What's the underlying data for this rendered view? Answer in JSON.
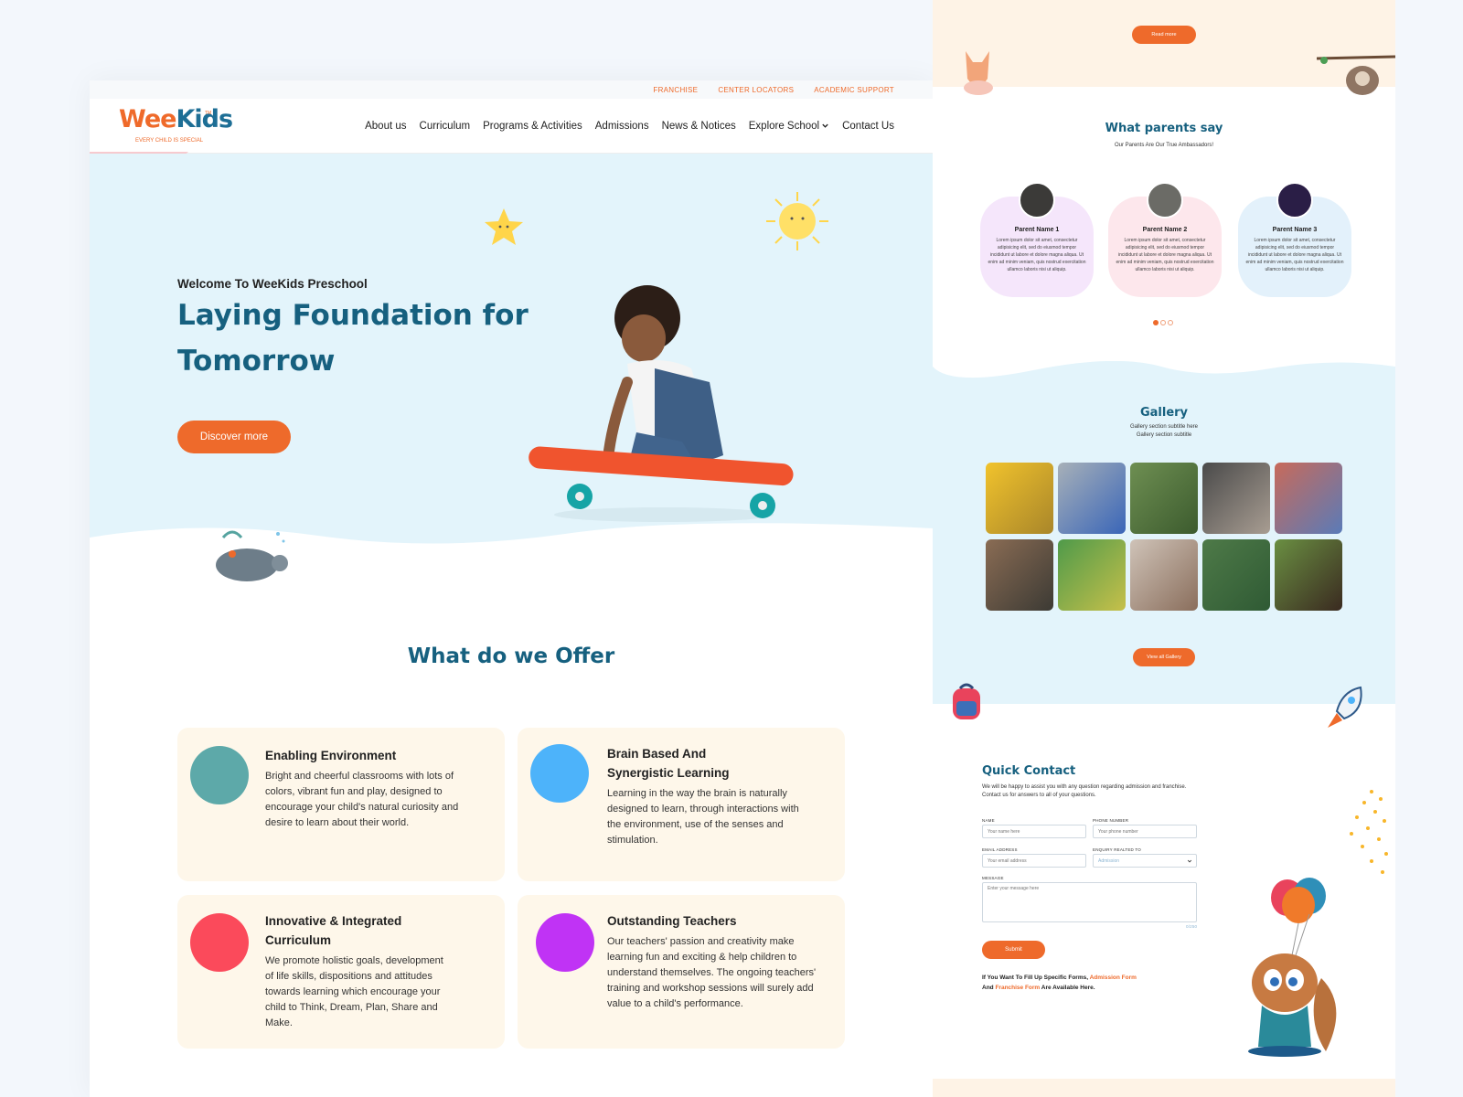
{
  "topbar": {
    "links": [
      "FRANCHISE",
      "CENTER LOCATORS",
      "ACADEMIC SUPPORT"
    ]
  },
  "brand": {
    "name_wee": "Wee",
    "name_kids": "Kids",
    "tagline": "EVERY CHILD IS SPECIAL",
    "tm": "TM"
  },
  "nav": {
    "items": [
      "About us",
      "Curriculum",
      "Programs & Activities",
      "Admissions",
      "News & Notices",
      "Explore School",
      "Contact Us"
    ]
  },
  "hero": {
    "welcome": "Welcome To WeeKids Preschool",
    "title": "Laying Foundation for Tomorrow",
    "button": "Discover more"
  },
  "offer": {
    "title": "What do we Offer",
    "cards": [
      {
        "title": "Enabling Environment",
        "text": "Bright and cheerful classrooms with lots of colors, vibrant fun and play, designed to encourage your child's natural curiosity and desire to learn about their world.",
        "color": "#5da9a9"
      },
      {
        "title": "Brain Based And Synergistic Learning",
        "text": "Learning in the way the brain is naturally designed to learn, through interactions with the environment, use of the senses and stimulation.",
        "color": "#4db3fa"
      },
      {
        "title": "Innovative & Integrated Curriculum",
        "text": "We promote holistic goals, development of life skills, dispositions and attitudes towards learning which encourage your child to Think, Dream, Plan, Share and Make.",
        "color": "#fb4a5b"
      },
      {
        "title": "Outstanding Teachers",
        "text": "Our teachers' passion and creativity make learning fun and exciting & help children to understand themselves. The ongoing teachers' training and workshop sessions will surely add value to a child's performance.",
        "color": "#c033f5"
      }
    ]
  },
  "right": {
    "read_more": "Read more",
    "testimonials": {
      "title": "What parents say",
      "subtitle": "Our Parents Are Our True Ambassadors!",
      "items": [
        {
          "name": "Parent Name 1",
          "text": "Lorem ipsum dolor sit amet, consectetur adipisicing elit, sed do eiusmod tempor incididunt ut labore et dolore magna aliqua. Ut enim ad minim veniam, quis nostrud exercitation ullamco laboris nisi ut aliquip.",
          "bg": "#f5e6fb"
        },
        {
          "name": "Parent Name 2",
          "text": "Lorem ipsum dolor sit amet, consectetur adipisicing elit, sed do eiusmod tempor incididunt ut labore et dolore magna aliqua. Ut enim ad minim veniam, quis nostrud exercitation ullamco laboris nisi ut aliquip.",
          "bg": "#fde7ec"
        },
        {
          "name": "Parent Name 3",
          "text": "Lorem ipsum dolor sit amet, consectetur adipisicing elit, sed do eiusmod tempor incididunt ut labore et dolore magna aliqua. Ut enim ad minim veniam, quis nostrud exercitation ullamco laboris nisi ut aliquip.",
          "bg": "#e3f1fb"
        }
      ]
    },
    "gallery": {
      "title": "Gallery",
      "subtitle1": "Gallery section subtitle here",
      "subtitle2": "Gallery section subtitle",
      "button": "View all Gallery"
    },
    "contact": {
      "title": "Quick Contact",
      "desc": "We will be happy to assist you with any question regarding admission and franchise. Contact us for answers to all of your questions.",
      "name_label": "NAME",
      "name_ph": "Your name here",
      "phone_label": "PHONE NUMBER",
      "phone_ph": "Your phone number",
      "email_label": "EMAIL ADDRESS",
      "email_ph": "Your email address",
      "enquiry_label": "ENQUIRY REALTED TO",
      "enquiry_value": "Admission",
      "message_label": "MESSAGE",
      "message_ph": "Enter your message here",
      "counter": "0/250",
      "submit": "Submit",
      "foot_a": "If You Want To Fill Up Specific Forms, ",
      "foot_link1": "Admission Form",
      "foot_b": " And ",
      "foot_link2": "Franchise Form",
      "foot_c": " Are Available Here."
    }
  },
  "colors": {
    "accent": "#ee6a2b",
    "heading": "#16607f",
    "hero_bg": "#e3f4fb",
    "card_bg": "#fef7ea"
  }
}
